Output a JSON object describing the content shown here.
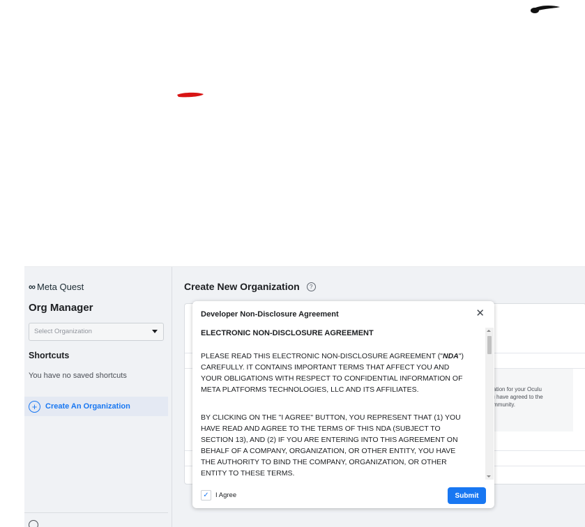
{
  "app": {
    "logo_text": "Meta Quest",
    "logo_mark": "∞"
  },
  "sidebar": {
    "title": "Org Manager",
    "select_placeholder": "Select Organization",
    "shortcuts_heading": "Shortcuts",
    "no_shortcuts_text": "You have no saved shortcuts",
    "create_org_label": "Create An Organization",
    "create_org_icon": "+"
  },
  "main": {
    "title": "Create New Organization",
    "help_icon": "?",
    "info_lines": [
      "ganization for your Oculu",
      "at you have agreed to the",
      "us community."
    ]
  },
  "modal": {
    "title": "Developer Non-Disclosure Agreement",
    "close_icon": "✕",
    "heading": "ELECTRONIC NON-DISCLOSURE AGREEMENT",
    "paragraph1_lines": [
      "PLEASE READ THIS ELECTRONIC NON-DISCLOSURE AGREEMENT (\"NDA\")",
      "CAREFULLY. IT CONTAINS IMPORTANT TERMS THAT AFFECT YOU AND",
      "YOUR OBLIGATIONS WITH RESPECT TO CONFIDENTIAL INFORMATION OF",
      "META PLATFORMS TECHNOLOGIES, LLC AND ITS AFFILIATES."
    ],
    "paragraph2_lines": [
      "BY CLICKING ON THE \"I AGREE\" BUTTON, YOU REPRESENT THAT (1) YOU",
      "HAVE READ AND AGREE TO THE TERMS OF THIS NDA (SUBJECT TO",
      "SECTION 13), AND (2) IF YOU ARE ENTERING INTO THIS AGREEMENT ON",
      "BEHALF OF A COMPANY, ORGANIZATION, OR OTHER ENTITY, YOU HAVE",
      "THE AUTHORITY TO BIND THE COMPANY, ORGANIZATION, OR OTHER",
      "ENTITY TO THESE TERMS."
    ],
    "agree_label": "I Agree",
    "agree_checked": true,
    "check_glyph": "✓",
    "submit_label": "Submit",
    "accent_color": "#1877f2"
  }
}
